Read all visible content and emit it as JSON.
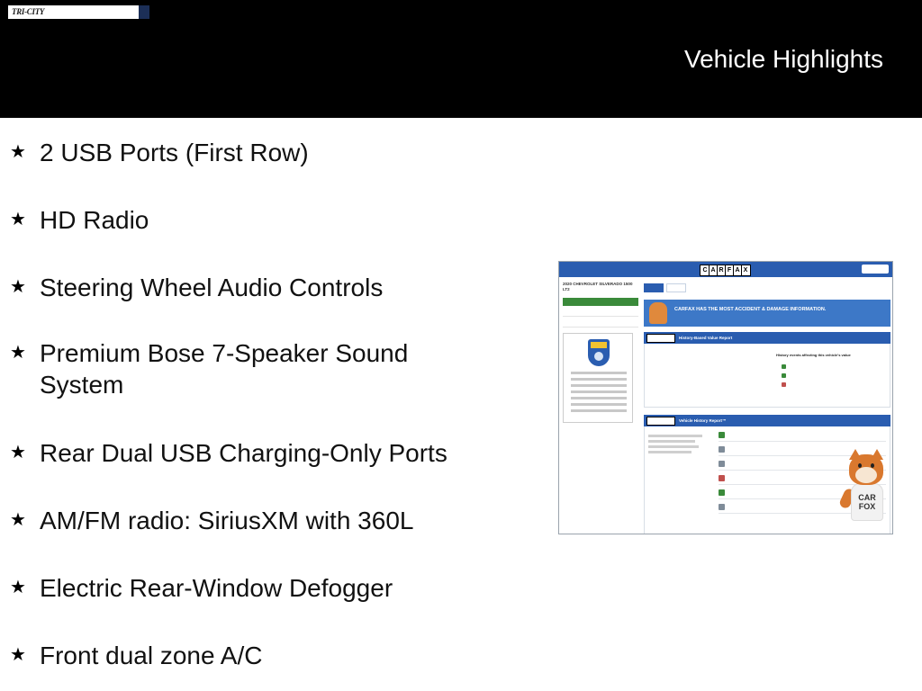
{
  "header": {
    "title": "Vehicle Highlights",
    "dealer_logo": {
      "name": "TRI-CITY",
      "background": "#000000"
    }
  },
  "features": {
    "bullet_icon": "star-icon",
    "items": [
      {
        "label": "2 USB Ports (First Row)"
      },
      {
        "label": "HD Radio"
      },
      {
        "label": "Steering Wheel Audio Controls"
      },
      {
        "label": "Premium Bose 7-Speaker Sound System"
      },
      {
        "label": "Rear Dual USB Charging-Only Ports"
      },
      {
        "label": "AM/FM radio: SiriusXM with 360L"
      },
      {
        "label": "Electric Rear-Window Defogger"
      },
      {
        "label": "Front dual zone A/C"
      }
    ]
  },
  "carfax_report": {
    "accent_color": "#2a5db0",
    "logo_letters": [
      "C",
      "A",
      "R",
      "F",
      "A",
      "X"
    ],
    "vehicle_title": "2020 CHEVROLET SILVERADO 1500 LT2",
    "banner_text": "CARFAX HAS THE MOST ACCIDENT & DAMAGE INFORMATION.",
    "value_section_title": "History-Based Value Report",
    "value_box_title": "History events affecting this vehicle's value",
    "history_section_title": "Vehicle History Report™",
    "fox_shirt_text": "CAR FOX"
  }
}
